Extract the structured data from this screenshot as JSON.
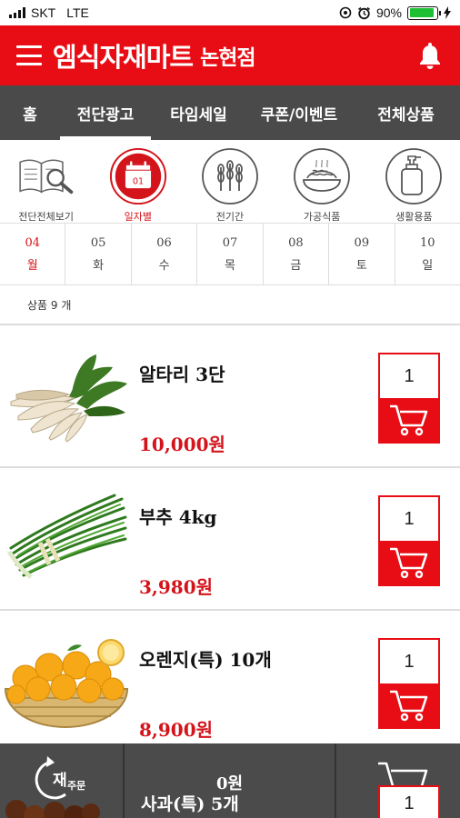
{
  "status_bar": {
    "carrier": "SKT",
    "network": "LTE",
    "battery": "90%"
  },
  "header": {
    "title": "엠식자재마트",
    "branch": "논현점"
  },
  "nav": {
    "tabs": [
      {
        "label": "홈"
      },
      {
        "label": "전단광고",
        "active": true
      },
      {
        "label": "타임세일"
      },
      {
        "label": "쿠폰/이벤트"
      },
      {
        "label": "전체상품"
      }
    ]
  },
  "categories": [
    {
      "label": "전단전체보기",
      "icon": "catalog-search-icon"
    },
    {
      "label": "일자별",
      "icon": "calendar-icon",
      "active": true
    },
    {
      "label": "전기간",
      "icon": "grain-icon"
    },
    {
      "label": "가공식품",
      "icon": "noodle-dish-icon"
    },
    {
      "label": "생활용품",
      "icon": "pump-bottle-icon"
    }
  ],
  "dates": [
    {
      "day": "04",
      "weekday": "월",
      "active": true
    },
    {
      "day": "05",
      "weekday": "화"
    },
    {
      "day": "06",
      "weekday": "수"
    },
    {
      "day": "07",
      "weekday": "목"
    },
    {
      "day": "08",
      "weekday": "금"
    },
    {
      "day": "09",
      "weekday": "토"
    },
    {
      "day": "10",
      "weekday": "일"
    }
  ],
  "product_count": "상품 9 개",
  "products": [
    {
      "name": "알타리 3단",
      "price": "10,000원",
      "qty": "1",
      "image": "radish-image"
    },
    {
      "name": "부추 4kg",
      "price": "3,980원",
      "qty": "1",
      "image": "chives-image"
    },
    {
      "name": "오렌지(특) 10개",
      "price": "8,900원",
      "qty": "1",
      "image": "orange-basket-image"
    }
  ],
  "bottom_bar": {
    "reorder_label_main": "재",
    "reorder_label_sub": "주문",
    "total": "0원",
    "peek_name": "사과(특) 5개",
    "peek_qty": "1"
  },
  "colors": {
    "brand": "#e80d14",
    "nav": "#4a4a4a",
    "price": "#d4141b"
  }
}
